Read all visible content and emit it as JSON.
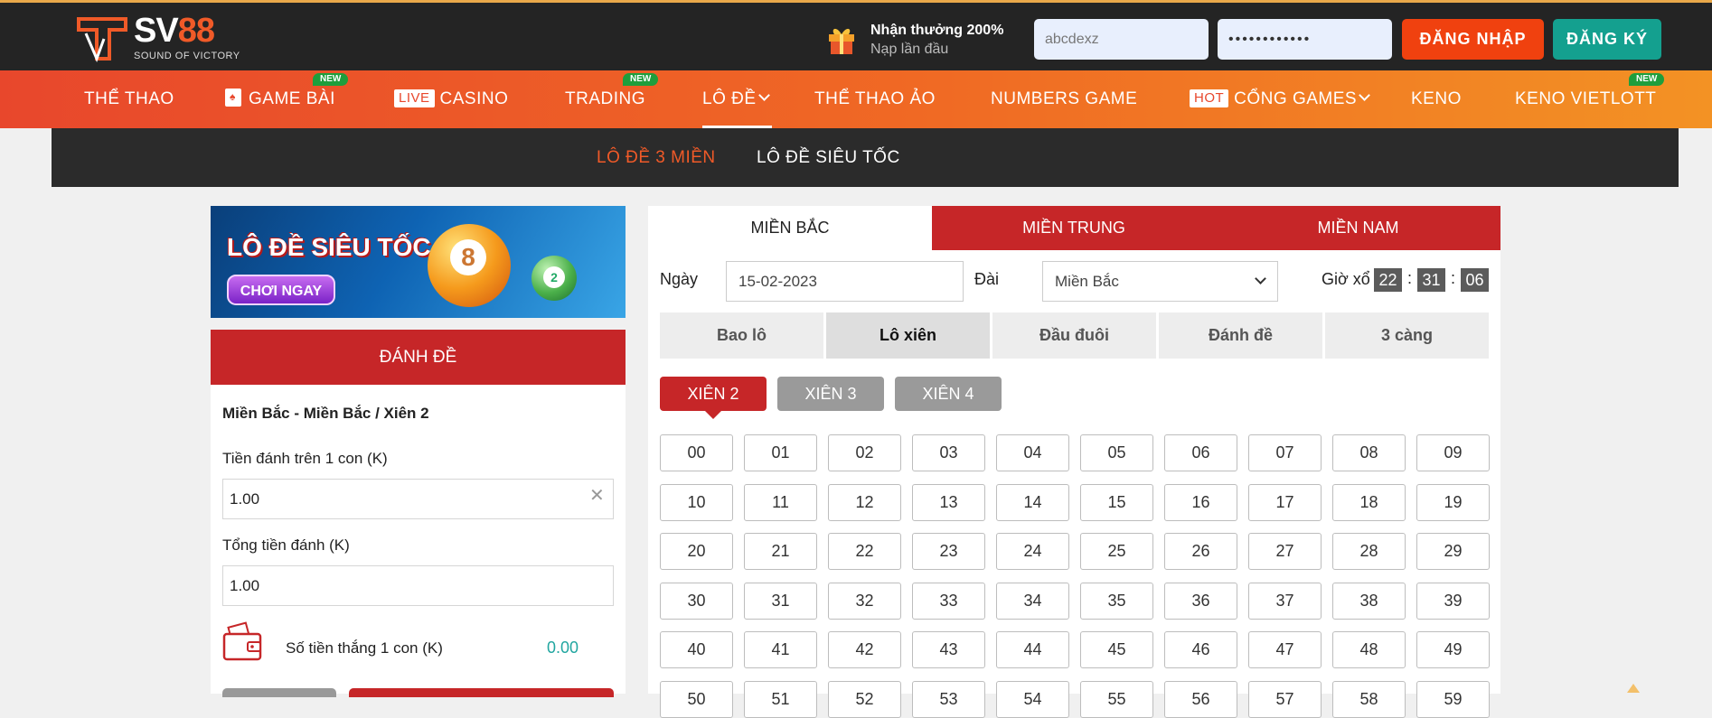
{
  "header": {
    "brand": "SV88",
    "brand_main": "SV",
    "brand_num": "88",
    "tagline": "SOUND OF VICTORY",
    "promo_title": "Nhận thưởng 200%",
    "promo_sub": "Nạp lần đầu",
    "username_value": "abcdexz",
    "password_value": "••••••••••••",
    "login_label": "ĐĂNG NHẬP",
    "register_label": "ĐĂNG KÝ",
    "icons": [
      "logo-icon",
      "gift-icon"
    ]
  },
  "nav": {
    "items": [
      {
        "label": "THỂ THAO"
      },
      {
        "label": "GAME BÀI",
        "badge": "NEW",
        "icon": "cards-icon"
      },
      {
        "label": "CASINO",
        "pill": "LIVE"
      },
      {
        "label": "TRADING",
        "badge": "NEW"
      },
      {
        "label": "LÔ ĐỀ",
        "active": true
      },
      {
        "label": "THỂ THAO ẢO"
      },
      {
        "label": "NUMBERS GAME"
      },
      {
        "label": "CỔNG GAMES",
        "pill": "HOT"
      },
      {
        "label": "KENO"
      },
      {
        "label": "KENO VIETLOTT",
        "badge": "NEW"
      }
    ]
  },
  "subnav": {
    "items": [
      {
        "label": "LÔ ĐỀ 3 MIỀN",
        "active": true
      },
      {
        "label": "LÔ ĐỀ SIÊU TỐC"
      }
    ]
  },
  "banner": {
    "title": "LÔ ĐỀ SIÊU TỐC",
    "cta": "CHƠI NGAY",
    "ball1": "8",
    "ball2": "2"
  },
  "bet_panel": {
    "header": "ĐÁNH ĐỀ",
    "selection": "Miền Bắc - Miền Bắc / Xiên 2",
    "stake_label": "Tiền đánh trên 1 con (K)",
    "stake_value": "1.00",
    "total_label": "Tổng tiền đánh (K)",
    "total_value": "1.00",
    "win_label": "Số tiền thắng 1 con (K)",
    "win_value": "0.00"
  },
  "region_tabs": [
    {
      "label": "MIỀN BẮC",
      "active": true
    },
    {
      "label": "MIỀN TRUNG"
    },
    {
      "label": "MIỀN NAM"
    }
  ],
  "filters": {
    "date_label": "Ngày",
    "date_value": "15-02-2023",
    "station_label": "Đài",
    "station_value": "Miền Bắc",
    "draw_time_label": "Giờ xổ",
    "time_h": "22",
    "time_m": "31",
    "time_s": "06"
  },
  "bet_types": [
    {
      "label": "Bao lô"
    },
    {
      "label": "Lô xiên",
      "active": true
    },
    {
      "label": "Đầu đuôi"
    },
    {
      "label": "Đánh đề"
    },
    {
      "label": "3 càng"
    }
  ],
  "xien_tabs": [
    {
      "label": "XIÊN 2",
      "active": true
    },
    {
      "label": "XIÊN 3"
    },
    {
      "label": "XIÊN 4"
    }
  ],
  "numbers": [
    "00",
    "01",
    "02",
    "03",
    "04",
    "05",
    "06",
    "07",
    "08",
    "09",
    "10",
    "11",
    "12",
    "13",
    "14",
    "15",
    "16",
    "17",
    "18",
    "19",
    "20",
    "21",
    "22",
    "23",
    "24",
    "25",
    "26",
    "27",
    "28",
    "29",
    "30",
    "31",
    "32",
    "33",
    "34",
    "35",
    "36",
    "37",
    "38",
    "39",
    "40",
    "41",
    "42",
    "43",
    "44",
    "45",
    "46",
    "47",
    "48",
    "49",
    "50",
    "51",
    "52",
    "53",
    "54",
    "55",
    "56",
    "57",
    "58",
    "59"
  ],
  "colors": {
    "accent_red": "#c62628",
    "orange": "#f05a28",
    "teal": "#14a08f",
    "win_value": "#21a6a0"
  }
}
